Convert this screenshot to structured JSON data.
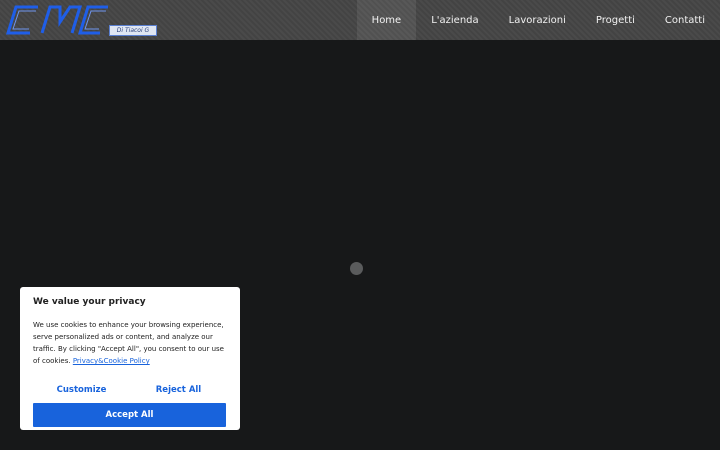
{
  "header": {
    "logo_text": "CMC",
    "logo_tag": "Di Tiacoi G",
    "nav": [
      {
        "label": "Home"
      },
      {
        "label": "L'azienda"
      },
      {
        "label": "Lavorazioni"
      },
      {
        "label": "Progetti"
      },
      {
        "label": "Contatti"
      }
    ]
  },
  "cookie_banner": {
    "title": "We value your privacy",
    "body": "We use cookies to enhance your browsing experience, serve personalized ads or content, and analyze our traffic. By clicking \"Accept All\", you consent to our use of cookies.",
    "link_label": "Privacy&Cookie Policy",
    "customize_label": "Customize",
    "reject_label": "Reject All",
    "accept_label": "Accept All"
  },
  "colors": {
    "background": "#171819",
    "logo_blue": "#1f5ee8",
    "button_blue": "#1863dc"
  }
}
